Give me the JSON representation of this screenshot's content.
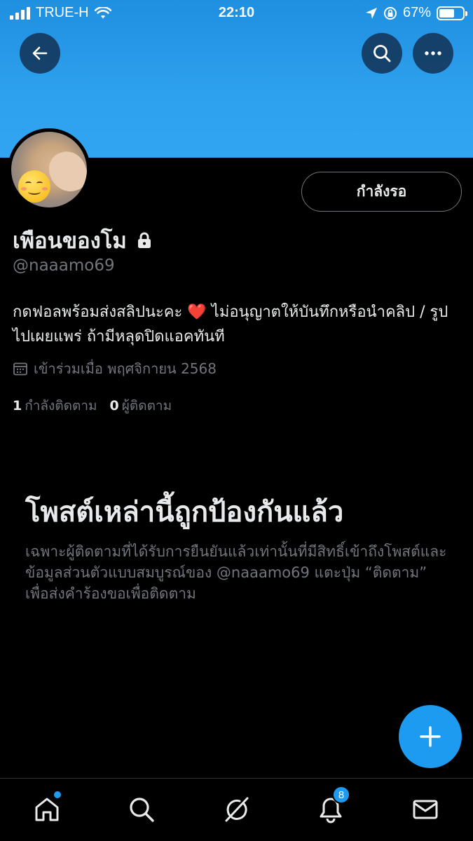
{
  "status_bar": {
    "carrier": "TRUE-H",
    "time": "22:10",
    "battery_percent": "67%",
    "battery_level": 0.67
  },
  "header": {
    "back_icon": "arrow-left-icon",
    "search_icon": "search-icon",
    "more_icon": "more-horizontal-icon",
    "banner_color": "#2ea1ee"
  },
  "profile": {
    "display_name": "เพือนของโม",
    "handle": "@naaamo69",
    "bio_part1": "กดฟอลพร้อมส่งสลิปนะคะ",
    "bio_heart": "❤️",
    "bio_part2": "ไม่อนุญาตให้บันทึกหรือนำคลิป / รูปไปเผยแพร่ ถ้ามีหลุดปิดแอคทันที",
    "joined": "เข้าร่วมเมื่อ พฤศจิกายน 2568",
    "following_count": "1",
    "following_label": "กำลังติดตาม",
    "followers_count": "0",
    "followers_label": "ผู้ติดตาม",
    "pending_button": "กำลังรอ"
  },
  "protected": {
    "title": "โพสต์เหล่านี้ถูกป้องกันแล้ว",
    "description": "เฉพาะผู้ติดตามที่ได้รับการยืนยันแล้วเท่านั้นที่มีสิทธิ์เข้าถึงโพสต์และข้อมูลส่วนตัวแบบสมบูรณ์ของ @naaamo69 แตะปุ่ม “ติดตาม” เพื่อส่งคำร้องขอเพื่อติดตาม"
  },
  "tabbar": {
    "notifications_badge": "8",
    "accent": "#1d9bf0"
  }
}
